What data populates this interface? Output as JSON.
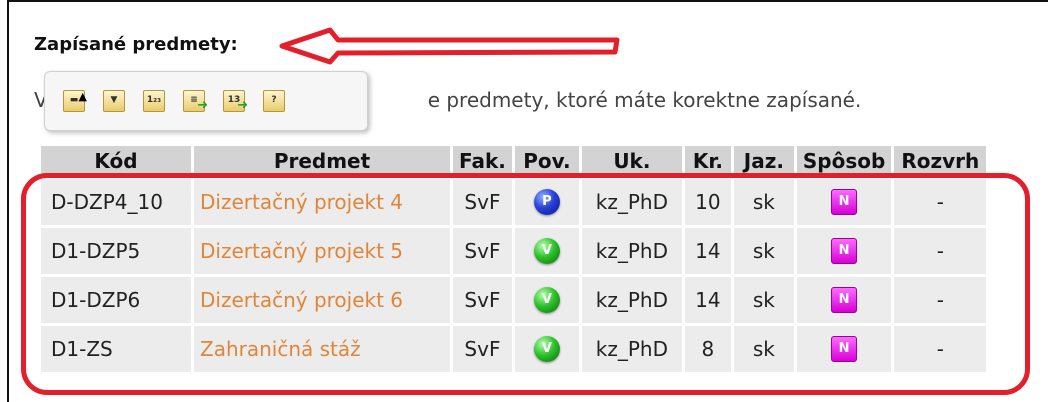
{
  "section_title": "Zapísané predmety:",
  "intro_text_before_toolbar": "V",
  "intro_text_visible": "e predmety, ktoré máte korektne zapísané.",
  "toolbar": {
    "buttons": [
      {
        "icon": "sort-icon"
      },
      {
        "icon": "filter-icon"
      },
      {
        "icon": "number-list-icon",
        "glyph": "1₂₃"
      },
      {
        "icon": "export-icon"
      },
      {
        "icon": "export-numbered-icon",
        "glyph": "13"
      },
      {
        "icon": "help-icon",
        "glyph": "?"
      }
    ]
  },
  "table": {
    "headers": [
      "Kód",
      "Predmet",
      "Fak.",
      "Pov.",
      "Uk.",
      "Kr.",
      "Jaz.",
      "Spôsob",
      "Rozvrh"
    ],
    "rows": [
      {
        "code": "D-DZP4_10",
        "subject": "Dizertačný projekt 4",
        "faculty": "SvF",
        "type": "P",
        "completion": "kz_PhD",
        "credits": "10",
        "language": "sk",
        "method": "N",
        "schedule": "-"
      },
      {
        "code": "D1-DZP5",
        "subject": "Dizertačný projekt 5",
        "faculty": "SvF",
        "type": "V",
        "completion": "kz_PhD",
        "credits": "14",
        "language": "sk",
        "method": "N",
        "schedule": "-"
      },
      {
        "code": "D1-DZP6",
        "subject": "Dizertačný projekt 6",
        "faculty": "SvF",
        "type": "V",
        "completion": "kz_PhD",
        "credits": "14",
        "language": "sk",
        "method": "N",
        "schedule": "-"
      },
      {
        "code": "D1-ZS",
        "subject": "Zahraničná stáž",
        "faculty": "SvF",
        "type": "V",
        "completion": "kz_PhD",
        "credits": "8",
        "language": "sk",
        "method": "N",
        "schedule": "-"
      }
    ]
  },
  "colors": {
    "subject_link": "#e0853a",
    "header_bg": "#d3d3d3",
    "row_bg": "#ececec",
    "annotation_red": "#e21f2a",
    "badge_p": "#2740d8",
    "badge_v": "#2ec42a",
    "badge_n": "#e800e8"
  }
}
